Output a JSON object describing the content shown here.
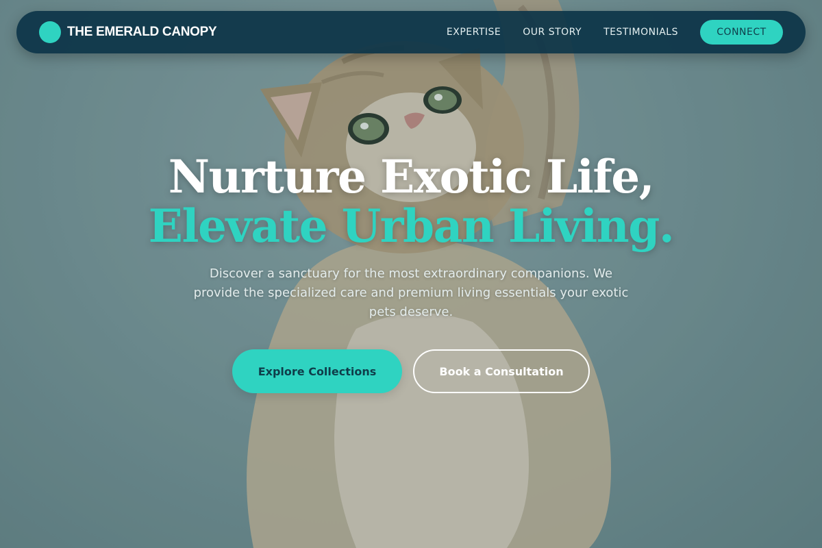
{
  "nav": {
    "brand_name": "THE EMERALD CANOPY",
    "brand_logo_icon": "circle-logo-icon",
    "links": [
      "EXPERTISE",
      "OUR STORY",
      "TESTIMONIALS"
    ],
    "cta_label": "CONNECT"
  },
  "hero": {
    "headline_line1": "Nurture Exotic Life,",
    "headline_line2": "Elevate Urban Living.",
    "subtext": "Discover a sanctuary for the most extraordinary companions. We provide the specialized care and premium living essentials your exotic pets deserve.",
    "primary_button": "Explore Collections",
    "secondary_button": "Book a Consultation",
    "background_image": "kitten-reaching-up-photo"
  },
  "colors": {
    "accent": "#2fd3c1",
    "nav_background": "#0c3448",
    "button_text_dark": "#0f3d4a",
    "headline_white": "#ffffff"
  }
}
